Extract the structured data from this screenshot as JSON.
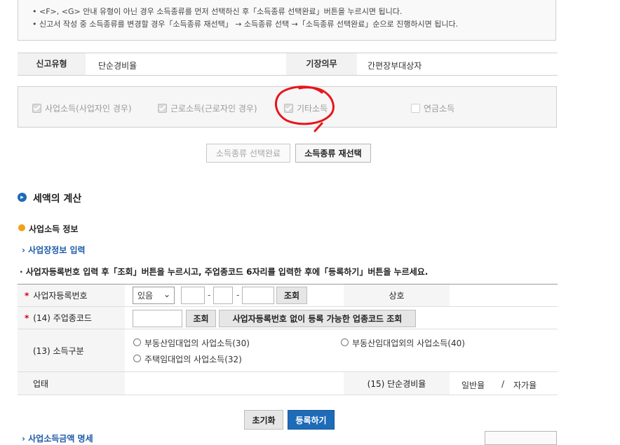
{
  "notice": {
    "line1": "• <F>, <G> 안내 유형이 아닌 경우 소득종류를 먼저 선택하신 후「소득종류 선택완료」버튼을 누르시면 됩니다.",
    "line2": "• 신고서 작성 중 소득종류를 변경할 경우「소득종류 재선택」 → 소득종류 선택 →「소득종류 선택완료」순으로 진행하시면 됩니다."
  },
  "report": {
    "type_label": "신고유형",
    "type_value": "단순경비율",
    "duty_label": "기장의무",
    "duty_value": "간편장부대상자"
  },
  "income_types": [
    {
      "label": "사업소득(사업자인 경우)",
      "checked": true
    },
    {
      "label": "근로소득(근로자인 경우)",
      "checked": true
    },
    {
      "label": "기타소득",
      "checked": true
    },
    {
      "label": "연금소득",
      "checked": false
    }
  ],
  "income_buttons": {
    "complete": "소득종류 선택완료",
    "reselect": "소득종류 재선택"
  },
  "tax_section": {
    "title": "세액의 계산",
    "biz_info_title": "사업소득 정보",
    "biz_place_link": "사업장정보 입력",
    "instruction": "· 사업자등록번호 입력 후「조회」버튼을 누르시고, 주업종코드 6자리를 입력한 후에「등록하기」버튼을 누르세요."
  },
  "biz_table": {
    "reg_no_label": "사업자등록번호",
    "reg_no_select": "있음",
    "lookup_btn": "조회",
    "trade_name_label": "상호",
    "industry_code_label": "(14) 주업종코드",
    "industry_lookup_btn": "조회",
    "no_reg_lookup_btn": "사업자등록번호 없이 등록 가능한 업종코드 조회",
    "income_class_label": "(13) 소득구분",
    "radio_options": [
      "부동산임대업의 사업소득(30)",
      "부동산임대업외의 사업소득(40)",
      "주택임대업의 사업소득(32)"
    ],
    "business_type_label": "업태",
    "simple_rate_label": "(15) 단순경비율",
    "rate_general": "일반율",
    "rate_sep": "/",
    "rate_self": "자가율"
  },
  "actions": {
    "reset": "초기화",
    "register": "등록하기"
  },
  "bottom": {
    "partial_link": "사업소득금액 명세"
  },
  "colors": {
    "primary": "#1e6bb8",
    "annotation": "#e8141c",
    "required": "#d0021b"
  }
}
